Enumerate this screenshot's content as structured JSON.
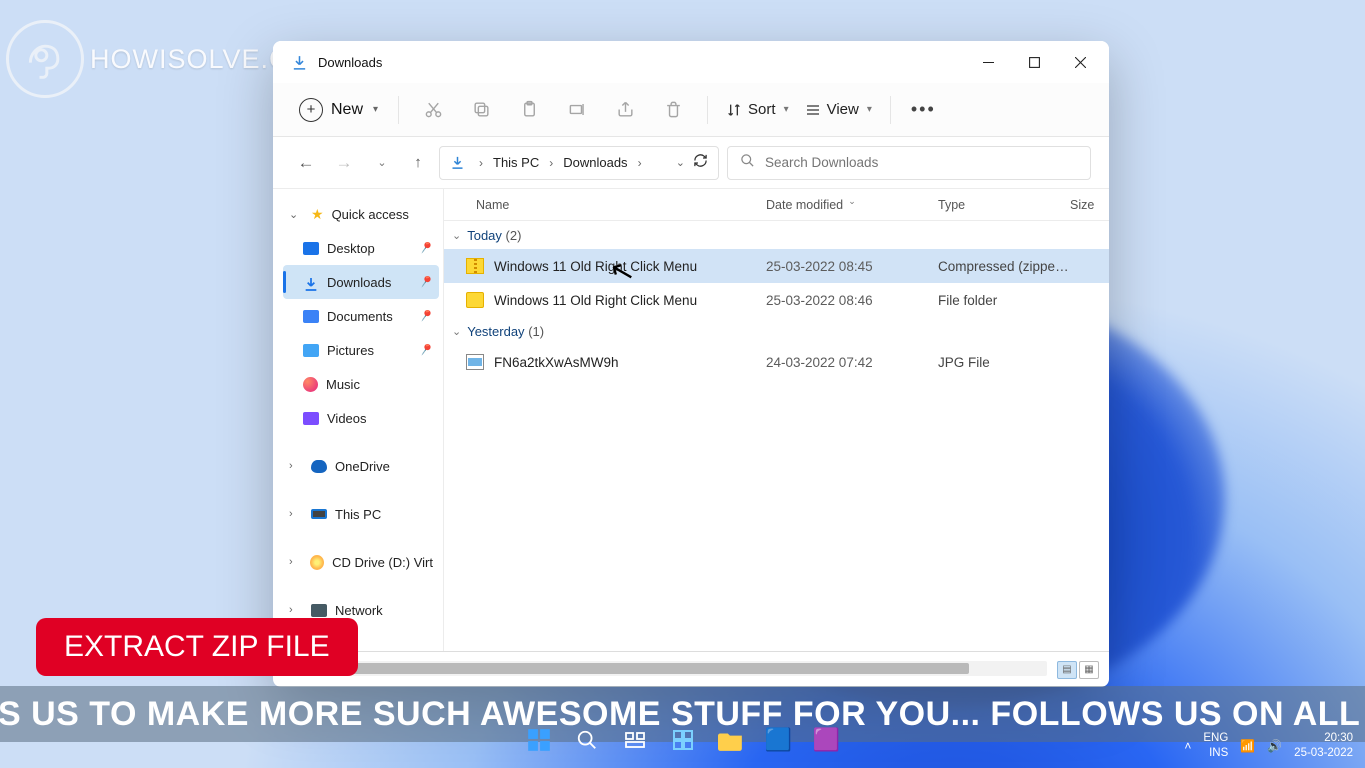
{
  "watermark": {
    "text": "HOWISOLVE.COM"
  },
  "caption": "EXTRACT ZIP FILE",
  "marquee": "S US TO MAKE MORE SUCH AWESOME STUFF FOR YOU...   FOLLOWS US ON ALL OUR SOCIAL MEDI",
  "taskbar": {
    "tray": {
      "lang": "ENG\nINS",
      "time": "20:30",
      "date": "25-03-2022"
    }
  },
  "explorer": {
    "title": "Downloads",
    "toolbar": {
      "new_label": "New",
      "sort_label": "Sort",
      "view_label": "View"
    },
    "breadcrumb": {
      "level1": "This PC",
      "level2": "Downloads"
    },
    "search": {
      "placeholder": "Search Downloads"
    },
    "sidebar": {
      "quick_access": "Quick access",
      "desktop": "Desktop",
      "downloads": "Downloads",
      "documents": "Documents",
      "pictures": "Pictures",
      "music": "Music",
      "videos": "Videos",
      "onedrive": "OneDrive",
      "this_pc": "This PC",
      "cd_drive": "CD Drive (D:) VirtualB",
      "network": "Network"
    },
    "columns": {
      "name": "Name",
      "date": "Date modified",
      "type": "Type",
      "size": "Size"
    },
    "groups": [
      {
        "label": "Today",
        "count": "(2)",
        "rows": [
          {
            "name": "Windows 11 Old Right Click Menu",
            "date": "25-03-2022 08:45",
            "type": "Compressed (zipped)…",
            "icon": "zip",
            "selected": true
          },
          {
            "name": "Windows 11 Old Right Click Menu",
            "date": "25-03-2022 08:46",
            "type": "File folder",
            "icon": "folder",
            "selected": false
          }
        ]
      },
      {
        "label": "Yesterday",
        "count": "(1)",
        "rows": [
          {
            "name": "FN6a2tkXwAsMW9h",
            "date": "24-03-2022 07:42",
            "type": "JPG File",
            "icon": "jpg",
            "selected": false
          }
        ]
      }
    ]
  }
}
